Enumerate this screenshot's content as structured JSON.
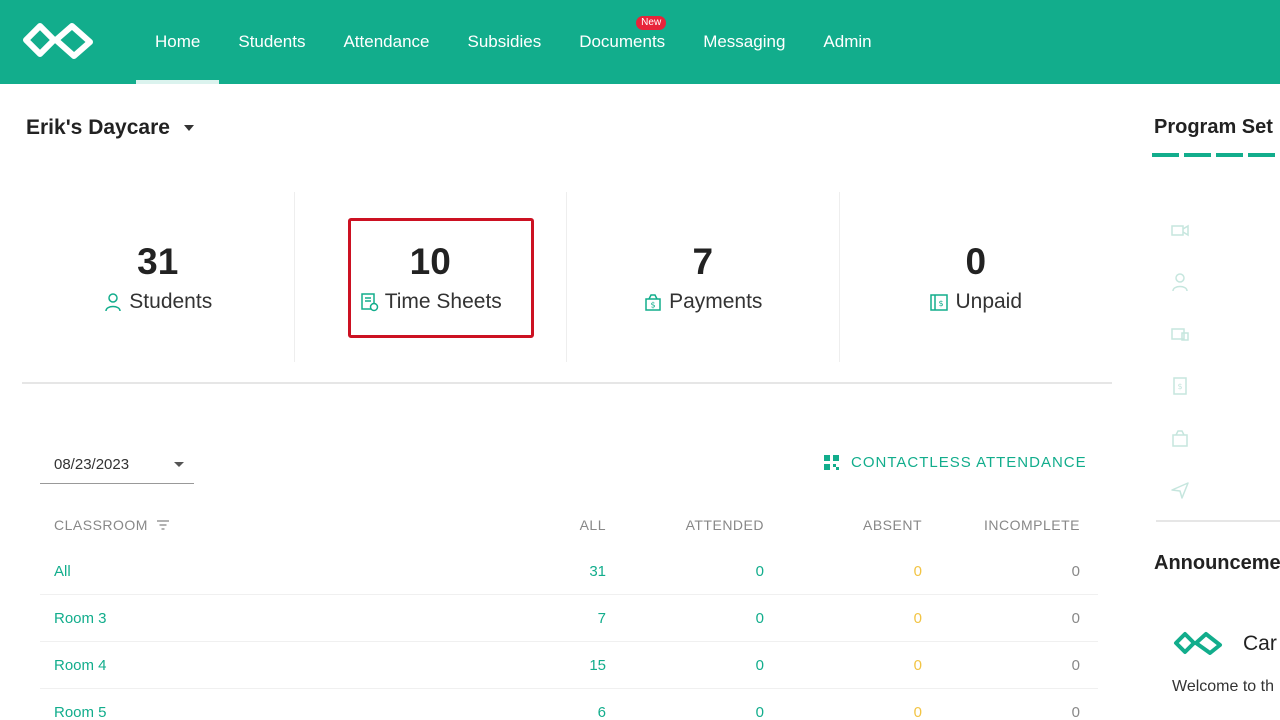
{
  "nav": {
    "items": [
      {
        "label": "Home",
        "active": true
      },
      {
        "label": "Students"
      },
      {
        "label": "Attendance"
      },
      {
        "label": "Subsidies"
      },
      {
        "label": "Documents",
        "badge": "New"
      },
      {
        "label": "Messaging"
      },
      {
        "label": "Admin"
      }
    ]
  },
  "org": {
    "name": "Erik's Daycare"
  },
  "stats": [
    {
      "value": "31",
      "label": "Students",
      "icon": "person-icon"
    },
    {
      "value": "10",
      "label": "Time Sheets",
      "icon": "timesheet-icon",
      "highlighted": true
    },
    {
      "value": "7",
      "label": "Payments",
      "icon": "payment-bag-icon"
    },
    {
      "value": "0",
      "label": "Unpaid",
      "icon": "invoice-icon"
    }
  ],
  "attendance": {
    "date": "08/23/2023",
    "contactless_label": "CONTACTLESS ATTENDANCE",
    "columns": [
      "CLASSROOM",
      "ALL",
      "ATTENDED",
      "ABSENT",
      "INCOMPLETE"
    ],
    "rows": [
      {
        "classroom": "All",
        "all": "31",
        "attended": "0",
        "absent": "0",
        "incomplete": "0"
      },
      {
        "classroom": "Room 3",
        "all": "7",
        "attended": "0",
        "absent": "0",
        "incomplete": "0"
      },
      {
        "classroom": "Room 4",
        "all": "15",
        "attended": "0",
        "absent": "0",
        "incomplete": "0"
      },
      {
        "classroom": "Room 5",
        "all": "6",
        "attended": "0",
        "absent": "0",
        "incomplete": "0"
      }
    ]
  },
  "right_panel": {
    "setup_title": "Program Set",
    "announcements_title": "Announceme",
    "announcement_name": "Car",
    "announcement_text": "Welcome to th"
  },
  "colors": {
    "brand": "#12ad8c",
    "absent": "#f2c444",
    "highlight_border": "#cc1122",
    "badge": "#e8243a"
  }
}
